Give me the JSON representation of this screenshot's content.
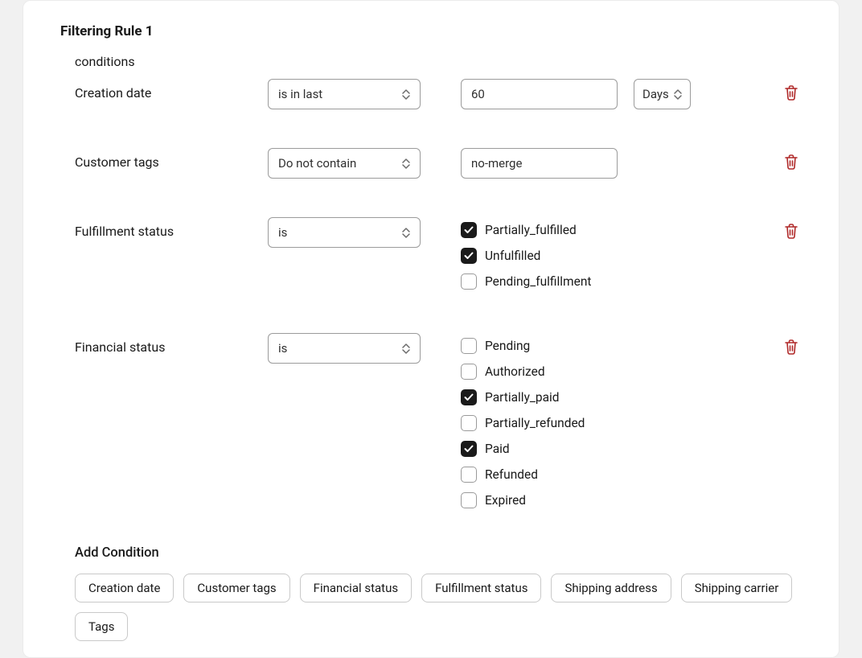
{
  "rule_title": "Filtering Rule 1",
  "conditions_label": "conditions",
  "rows": {
    "creation_date": {
      "label": "Creation date",
      "operator": "is in last",
      "value": "60",
      "unit": "Days"
    },
    "customer_tags": {
      "label": "Customer tags",
      "operator": "Do not contain",
      "value": "no-merge"
    },
    "fulfillment_status": {
      "label": "Fulfillment status",
      "operator": "is",
      "options": [
        {
          "label": "Partially_fulfilled",
          "checked": true
        },
        {
          "label": "Unfulfilled",
          "checked": true
        },
        {
          "label": "Pending_fulfillment",
          "checked": false
        }
      ]
    },
    "financial_status": {
      "label": "Financial status",
      "operator": "is",
      "options": [
        {
          "label": "Pending",
          "checked": false
        },
        {
          "label": "Authorized",
          "checked": false
        },
        {
          "label": "Partially_paid",
          "checked": true
        },
        {
          "label": "Partially_refunded",
          "checked": false
        },
        {
          "label": "Paid",
          "checked": true
        },
        {
          "label": "Refunded",
          "checked": false
        },
        {
          "label": "Expired",
          "checked": false
        }
      ]
    }
  },
  "add_condition": {
    "title": "Add Condition",
    "chips": [
      "Creation date",
      "Customer tags",
      "Financial status",
      "Fulfillment status",
      "Shipping address",
      "Shipping carrier",
      "Tags"
    ]
  },
  "icons": {
    "trash": "trash-icon",
    "stepper": "stepper-icon",
    "check": "check-icon"
  },
  "colors": {
    "danger": "#b02a2a",
    "border": "#9b9b9b",
    "chip_border": "#c9c9c9",
    "text": "#1a1a1a",
    "bg": "#f1f1f1",
    "card": "#ffffff",
    "checked_bg": "#1a1a1a"
  }
}
